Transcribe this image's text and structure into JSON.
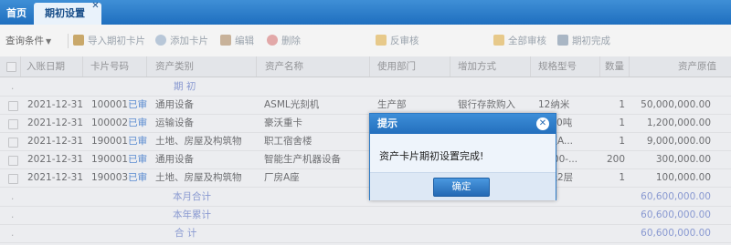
{
  "tabs": {
    "home_label": "首页",
    "active_label": "期初设置",
    "close_glyph": "✕"
  },
  "toolbar": {
    "query_label": "查询条件",
    "query_arrow": "▼",
    "buttons": [
      {
        "label": "导入期初卡片",
        "icon": "import-icon",
        "color": "#c9a86a"
      },
      {
        "label": "添加卡片",
        "icon": "add-icon",
        "color": "#b8c7d8"
      },
      {
        "label": "编辑",
        "icon": "edit-icon",
        "color": "#c8b29a"
      },
      {
        "label": "删除",
        "icon": "delete-icon",
        "color": "#e2a8a8"
      },
      {
        "label": "反审核",
        "icon": "unaudit-icon",
        "color": "#e7c98a"
      },
      {
        "label": "全部审核",
        "icon": "audit-all-icon",
        "color": "#e7c98a"
      },
      {
        "label": "期初完成",
        "icon": "finish-icon",
        "color": "#a9b6c4"
      }
    ]
  },
  "table": {
    "headers": [
      "入账日期",
      "卡片号码",
      "资产类别",
      "资产名称",
      "使用部门",
      "增加方式",
      "规格型号",
      "数量",
      "资产原值"
    ],
    "group_label": "期 初",
    "rows": [
      {
        "date": "2021-12-31",
        "card": "100001",
        "status": "已审",
        "category": "通用设备",
        "name": "ASML光刻机",
        "dept": "生产部",
        "method": "银行存款购入",
        "spec": "12纳米",
        "qty": "1",
        "value": "50,000,000.00"
      },
      {
        "date": "2021-12-31",
        "card": "100002",
        "status": "已审",
        "category": "运输设备",
        "name": "豪沃重卡",
        "dept": "",
        "method": "",
        "spec": "1500吨",
        "qty": "1",
        "value": "1,200,000.00"
      },
      {
        "date": "2021-12-31",
        "card": "190001",
        "status": "已审",
        "category": "土地、房屋及构筑物",
        "name": "职工宿舍楼",
        "dept": "",
        "method": "",
        "spec": "康区A...",
        "qty": "1",
        "value": "9,000,000.00"
      },
      {
        "date": "2021-12-31",
        "card": "190001",
        "status": "已审",
        "category": "通用设备",
        "name": "智能生产机器设备",
        "dept": "",
        "method": "",
        "spec": "T-100-...",
        "qty": "200",
        "value": "300,000.00"
      },
      {
        "date": "2021-12-31",
        "card": "190003",
        "status": "已审",
        "category": "土地、房屋及构筑物",
        "name": "厂房A座",
        "dept": "",
        "method": "",
        "spec": "平米2层",
        "qty": "1",
        "value": "100,000.00"
      }
    ],
    "summaries": [
      {
        "label": "本月合计",
        "value": "60,600,000.00"
      },
      {
        "label": "本年累计",
        "value": "60,600,000.00"
      },
      {
        "label": "合 计",
        "value": "60,600,000.00"
      }
    ]
  },
  "dialog": {
    "title": "提示",
    "message": "资产卡片期初设置完成!",
    "ok_label": "确定",
    "close_glyph": "✕"
  }
}
